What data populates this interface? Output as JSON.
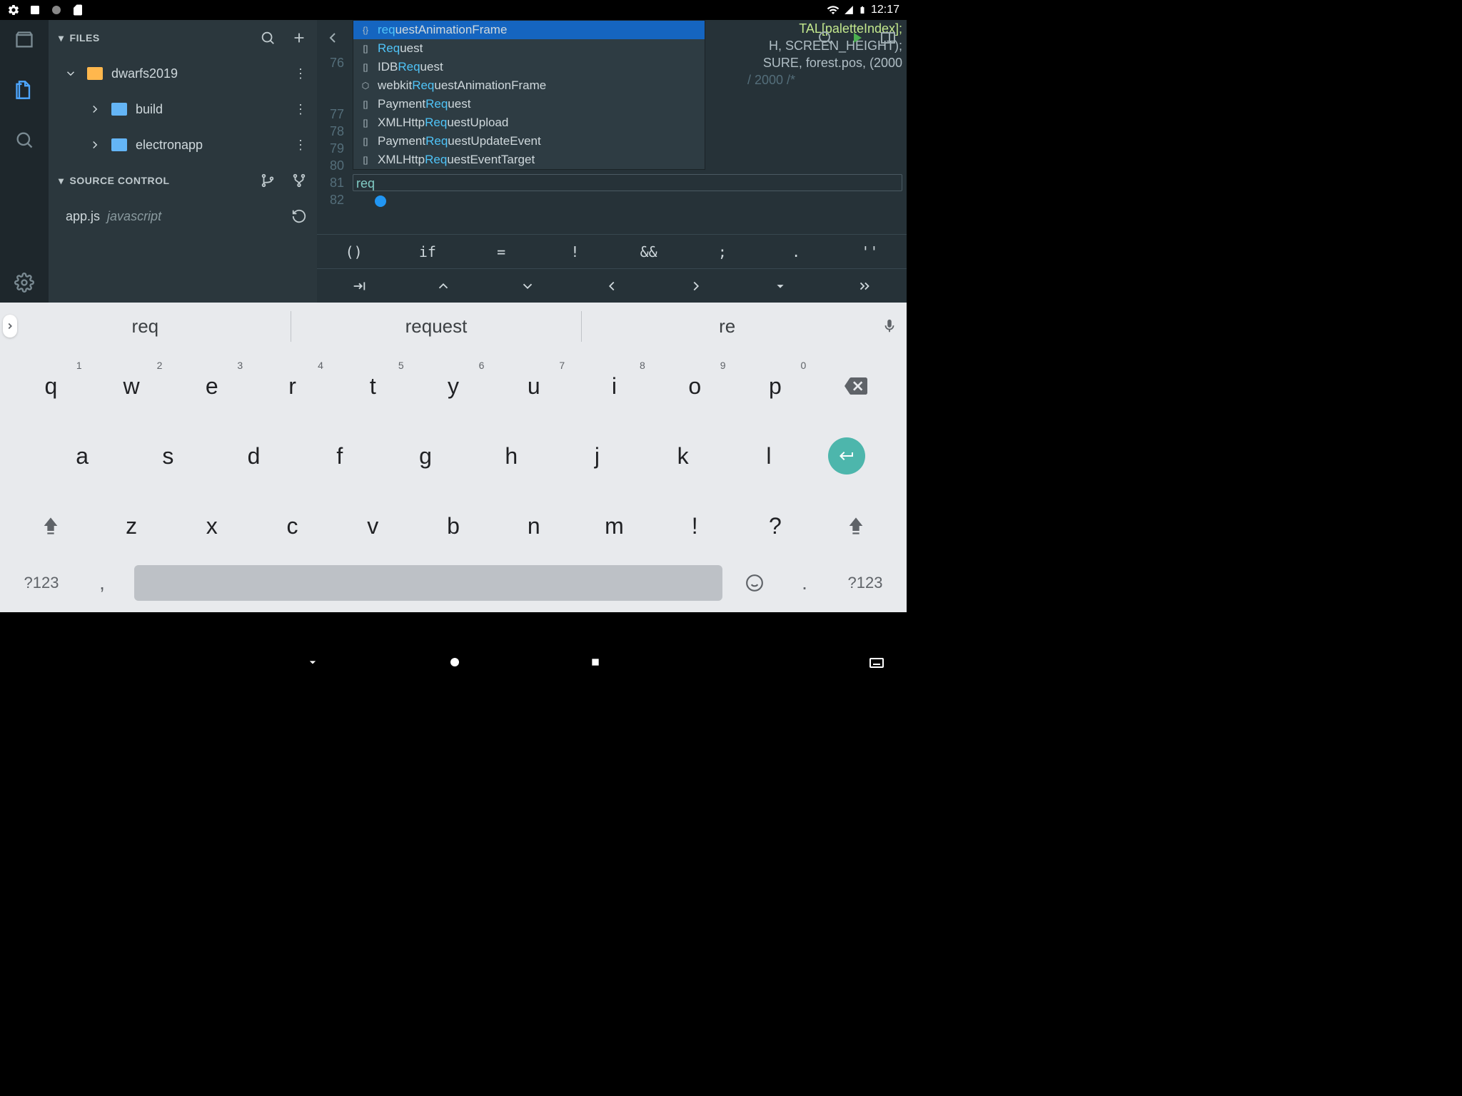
{
  "status": {
    "time": "12:17"
  },
  "sidebar": {
    "files_label": "FILES",
    "source_control_label": "SOURCE CONTROL",
    "tree": {
      "root": "dwarfs2019",
      "children": [
        {
          "name": "build"
        },
        {
          "name": "electronapp"
        }
      ]
    },
    "file": {
      "name": "app.js",
      "lang": "javascript"
    }
  },
  "editor": {
    "line_numbers": [
      "76",
      "77",
      "78",
      "79",
      "80",
      "81",
      "82"
    ],
    "background_code": {
      "l1": "TAL[paletteIndex];",
      "l2": "H, SCREEN_HEIGHT);",
      "l3_a": "SURE, forest.pos, (2000",
      "l3_b": "/ 2000 /*"
    },
    "typed": "req"
  },
  "autocomplete": [
    {
      "icon": "{}",
      "pre": "",
      "match": "req",
      "post": "uestAnimationFrame",
      "selected": true
    },
    {
      "icon": "[]",
      "pre": "",
      "match": "Req",
      "post": "uest"
    },
    {
      "icon": "[]",
      "pre": "IDB",
      "match": "Req",
      "post": "uest"
    },
    {
      "icon": "⬡",
      "pre": "webkit",
      "match": "Req",
      "post": "uestAnimationFrame"
    },
    {
      "icon": "[]",
      "pre": "Payment",
      "match": "Req",
      "post": "uest"
    },
    {
      "icon": "[]",
      "pre": "XMLHttp",
      "match": "Req",
      "post": "uestUpload"
    },
    {
      "icon": "[]",
      "pre": "Payment",
      "match": "Req",
      "post": "uestUpdateEvent"
    },
    {
      "icon": "[]",
      "pre": "XMLHttp",
      "match": "Req",
      "post": "uestEventTarget"
    }
  ],
  "symbol_row1": [
    "()",
    "if",
    "=",
    "!",
    "&&",
    ";",
    ".",
    "''"
  ],
  "suggestions": [
    "req",
    "request",
    "re"
  ],
  "keyboard": {
    "row1": [
      {
        "k": "q",
        "n": "1"
      },
      {
        "k": "w",
        "n": "2"
      },
      {
        "k": "e",
        "n": "3"
      },
      {
        "k": "r",
        "n": "4"
      },
      {
        "k": "t",
        "n": "5"
      },
      {
        "k": "y",
        "n": "6"
      },
      {
        "k": "u",
        "n": "7"
      },
      {
        "k": "i",
        "n": "8"
      },
      {
        "k": "o",
        "n": "9"
      },
      {
        "k": "p",
        "n": "0"
      }
    ],
    "row2": [
      "a",
      "s",
      "d",
      "f",
      "g",
      "h",
      "j",
      "k",
      "l"
    ],
    "row3": [
      "z",
      "x",
      "c",
      "v",
      "b",
      "n",
      "m",
      "!",
      "?"
    ],
    "mode": "?123",
    "comma": ",",
    "dot": "."
  }
}
